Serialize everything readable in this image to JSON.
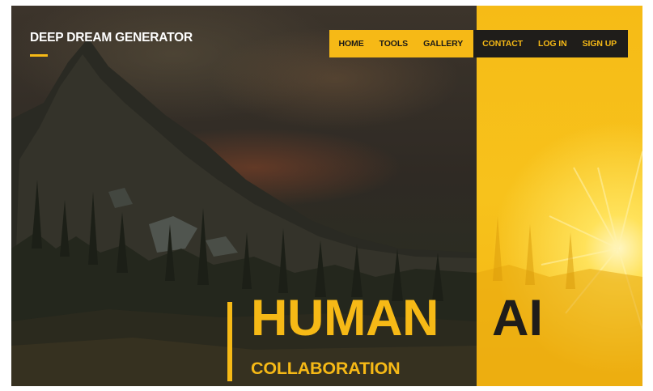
{
  "brand": {
    "title": "DEEP DREAM GENERATOR"
  },
  "nav": {
    "primary": [
      {
        "label": "HOME"
      },
      {
        "label": "TOOLS"
      },
      {
        "label": "GALLERY"
      }
    ],
    "secondary": [
      {
        "label": "CONTACT"
      },
      {
        "label": "LOG IN"
      },
      {
        "label": "SIGN UP"
      }
    ]
  },
  "hero": {
    "word_primary": "HUMAN",
    "word_secondary": "AI",
    "subtitle": "COLLABORATION"
  },
  "colors": {
    "accent": "#f6b916",
    "dark": "#1f1d1a",
    "text_light": "#ffffff"
  }
}
